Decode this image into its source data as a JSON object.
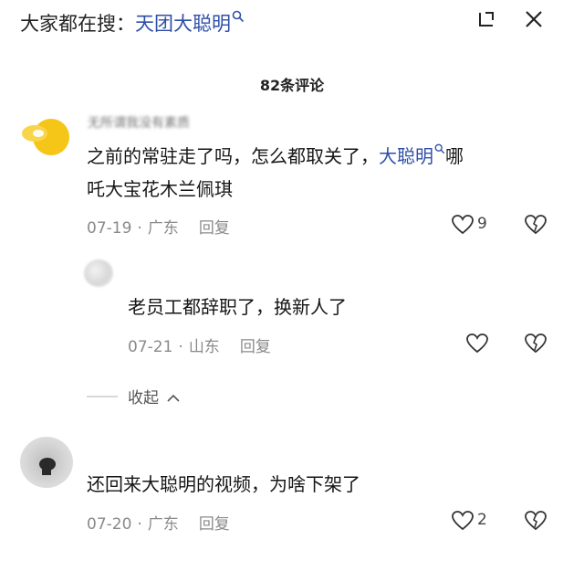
{
  "header": {
    "search_prefix": "大家都在搜：",
    "search_term": "天团大聪明",
    "icons": [
      "search-icon",
      "minimize-icon",
      "close-icon"
    ]
  },
  "comments_count": "82条评论",
  "comments": [
    {
      "username": "无所谓我没有素质",
      "text_before": "之前的常驻走了吗，怎么都取关了，",
      "link_text": "大聪明",
      "text_after": "哪",
      "text_line2": "吒大宝花木兰佩琪",
      "date": "07-19",
      "location": "广东",
      "reply_label": "回复",
      "likes": "9"
    },
    {
      "text": "还回来大聪明的视频，为啥下架了",
      "date": "07-20",
      "location": "广东",
      "reply_label": "回复",
      "likes": "2"
    }
  ],
  "reply": {
    "text": "老员工都辞职了，换新人了",
    "date": "07-21",
    "location": "山东",
    "reply_label": "回复"
  },
  "collapse_label": "收起",
  "colors": {
    "link": "#2f4fa8",
    "meta": "#8a8a8a",
    "avatar_yellow": "#f5c518"
  }
}
